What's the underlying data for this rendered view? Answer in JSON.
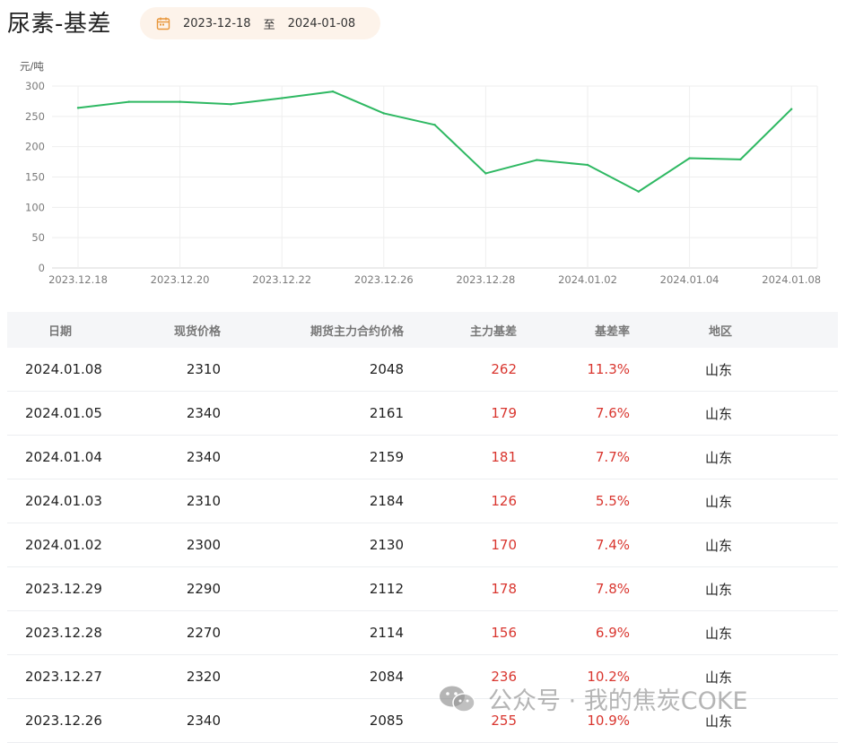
{
  "title": "尿素-基差",
  "date_range": {
    "start": "2023-12-18",
    "separator": "至",
    "end": "2024-01-08",
    "icon": "calendar-icon"
  },
  "chart_data": {
    "type": "line",
    "ylabel": "元/吨",
    "ylim": [
      0,
      300
    ],
    "yticks": [
      0,
      50,
      100,
      150,
      200,
      250,
      300
    ],
    "x_tick_labels": [
      "2023.12.18",
      "2023.12.20",
      "2023.12.22",
      "2023.12.26",
      "2023.12.28",
      "2024.01.02",
      "2024.01.04",
      "2024.01.08"
    ],
    "x": [
      "2023.12.18",
      "2023.12.19",
      "2023.12.20",
      "2023.12.21",
      "2023.12.22",
      "2023.12.25",
      "2023.12.26",
      "2023.12.27",
      "2023.12.28",
      "2023.12.29",
      "2024.01.02",
      "2024.01.03",
      "2024.01.04",
      "2024.01.05",
      "2024.01.08"
    ],
    "series": [
      {
        "values": [
          264,
          274,
          274,
          270,
          280,
          291,
          255,
          236,
          156,
          178,
          170,
          126,
          181,
          179,
          262
        ],
        "color": "#2eb862"
      }
    ],
    "grid": true
  },
  "table": {
    "headers": [
      "日期",
      "现货价格",
      "期货主力合约价格",
      "主力基差",
      "基差率",
      "地区"
    ],
    "rows": [
      [
        "2024.01.08",
        "2310",
        "2048",
        "262",
        "11.3%",
        "山东"
      ],
      [
        "2024.01.05",
        "2340",
        "2161",
        "179",
        "7.6%",
        "山东"
      ],
      [
        "2024.01.04",
        "2340",
        "2159",
        "181",
        "7.7%",
        "山东"
      ],
      [
        "2024.01.03",
        "2310",
        "2184",
        "126",
        "5.5%",
        "山东"
      ],
      [
        "2024.01.02",
        "2300",
        "2130",
        "170",
        "7.4%",
        "山东"
      ],
      [
        "2023.12.29",
        "2290",
        "2112",
        "178",
        "7.8%",
        "山东"
      ],
      [
        "2023.12.28",
        "2270",
        "2114",
        "156",
        "6.9%",
        "山东"
      ],
      [
        "2023.12.27",
        "2320",
        "2084",
        "236",
        "10.2%",
        "山东"
      ],
      [
        "2023.12.26",
        "2340",
        "2085",
        "255",
        "10.9%",
        "山东"
      ]
    ]
  },
  "watermark": {
    "text": "公众号 · 我的焦炭COKE",
    "icon": "wechat-icon"
  },
  "colors": {
    "accent_line": "#2eb862",
    "basis_red": "#d9362f",
    "pill_bg": "#fdf3ea",
    "calendar_orange": "#e8963a"
  }
}
